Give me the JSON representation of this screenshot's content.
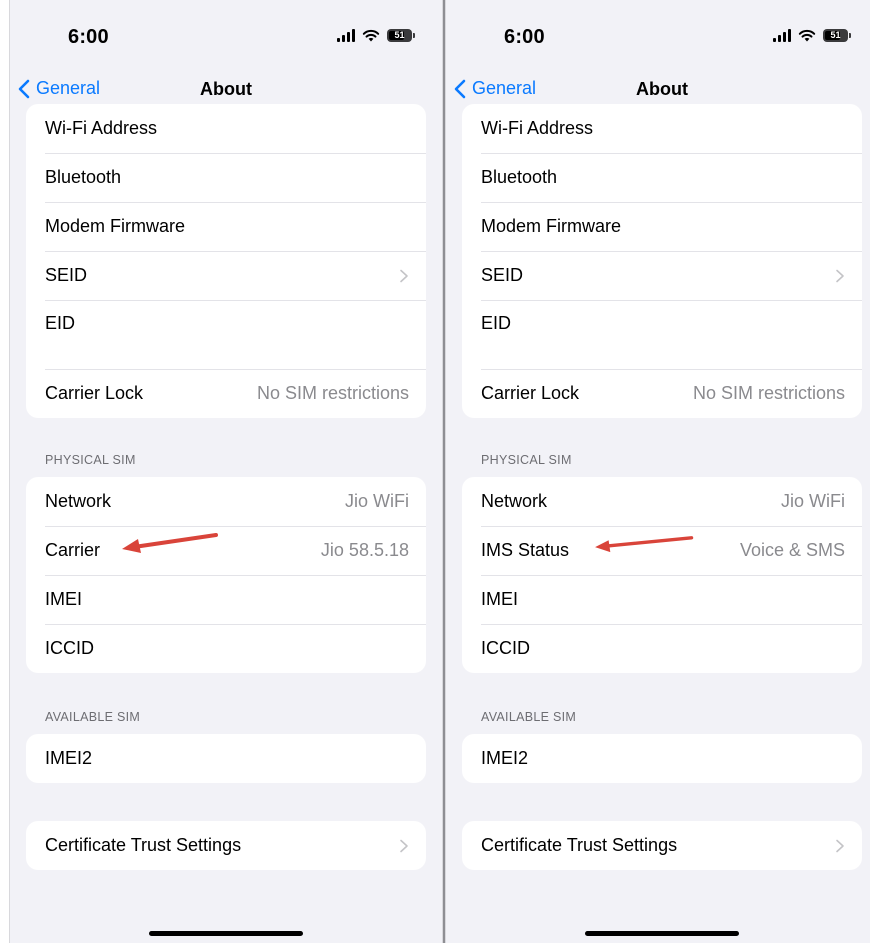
{
  "screens": [
    {
      "status_bar": {
        "time": "6:00",
        "battery": "51"
      },
      "nav": {
        "back_label": "General",
        "title": "About"
      },
      "about_rows": [
        {
          "label": "Wi-Fi Address",
          "value": ""
        },
        {
          "label": "Bluetooth",
          "value": ""
        },
        {
          "label": "Modem Firmware",
          "value": ""
        },
        {
          "label": "SEID",
          "value": ""
        },
        {
          "label": "EID",
          "value": ""
        },
        {
          "label": "Carrier Lock",
          "value": "No SIM restrictions"
        }
      ],
      "physical_sim": {
        "header": "PHYSICAL SIM",
        "rows": [
          {
            "label": "Network",
            "value": "Jio WiFi"
          },
          {
            "label": "Carrier",
            "value": "Jio 58.5.18"
          },
          {
            "label": "IMEI",
            "value": ""
          },
          {
            "label": "ICCID",
            "value": ""
          }
        ]
      },
      "available_sim": {
        "header": "AVAILABLE SIM",
        "rows": [
          {
            "label": "IMEI2",
            "value": ""
          }
        ]
      },
      "certificate": {
        "label": "Certificate Trust Settings"
      },
      "annotation_color": "#d9443a"
    },
    {
      "status_bar": {
        "time": "6:00",
        "battery": "51"
      },
      "nav": {
        "back_label": "General",
        "title": "About"
      },
      "about_rows": [
        {
          "label": "Wi-Fi Address",
          "value": ""
        },
        {
          "label": "Bluetooth",
          "value": ""
        },
        {
          "label": "Modem Firmware",
          "value": ""
        },
        {
          "label": "SEID",
          "value": ""
        },
        {
          "label": "EID",
          "value": ""
        },
        {
          "label": "Carrier Lock",
          "value": "No SIM restrictions"
        }
      ],
      "physical_sim": {
        "header": "PHYSICAL SIM",
        "rows": [
          {
            "label": "Network",
            "value": "Jio WiFi"
          },
          {
            "label": "IMS Status",
            "value": "Voice & SMS"
          },
          {
            "label": "IMEI",
            "value": ""
          },
          {
            "label": "ICCID",
            "value": ""
          }
        ]
      },
      "available_sim": {
        "header": "AVAILABLE SIM",
        "rows": [
          {
            "label": "IMEI2",
            "value": ""
          }
        ]
      },
      "certificate": {
        "label": "Certificate Trust Settings"
      },
      "annotation_color": "#d9443a"
    }
  ]
}
